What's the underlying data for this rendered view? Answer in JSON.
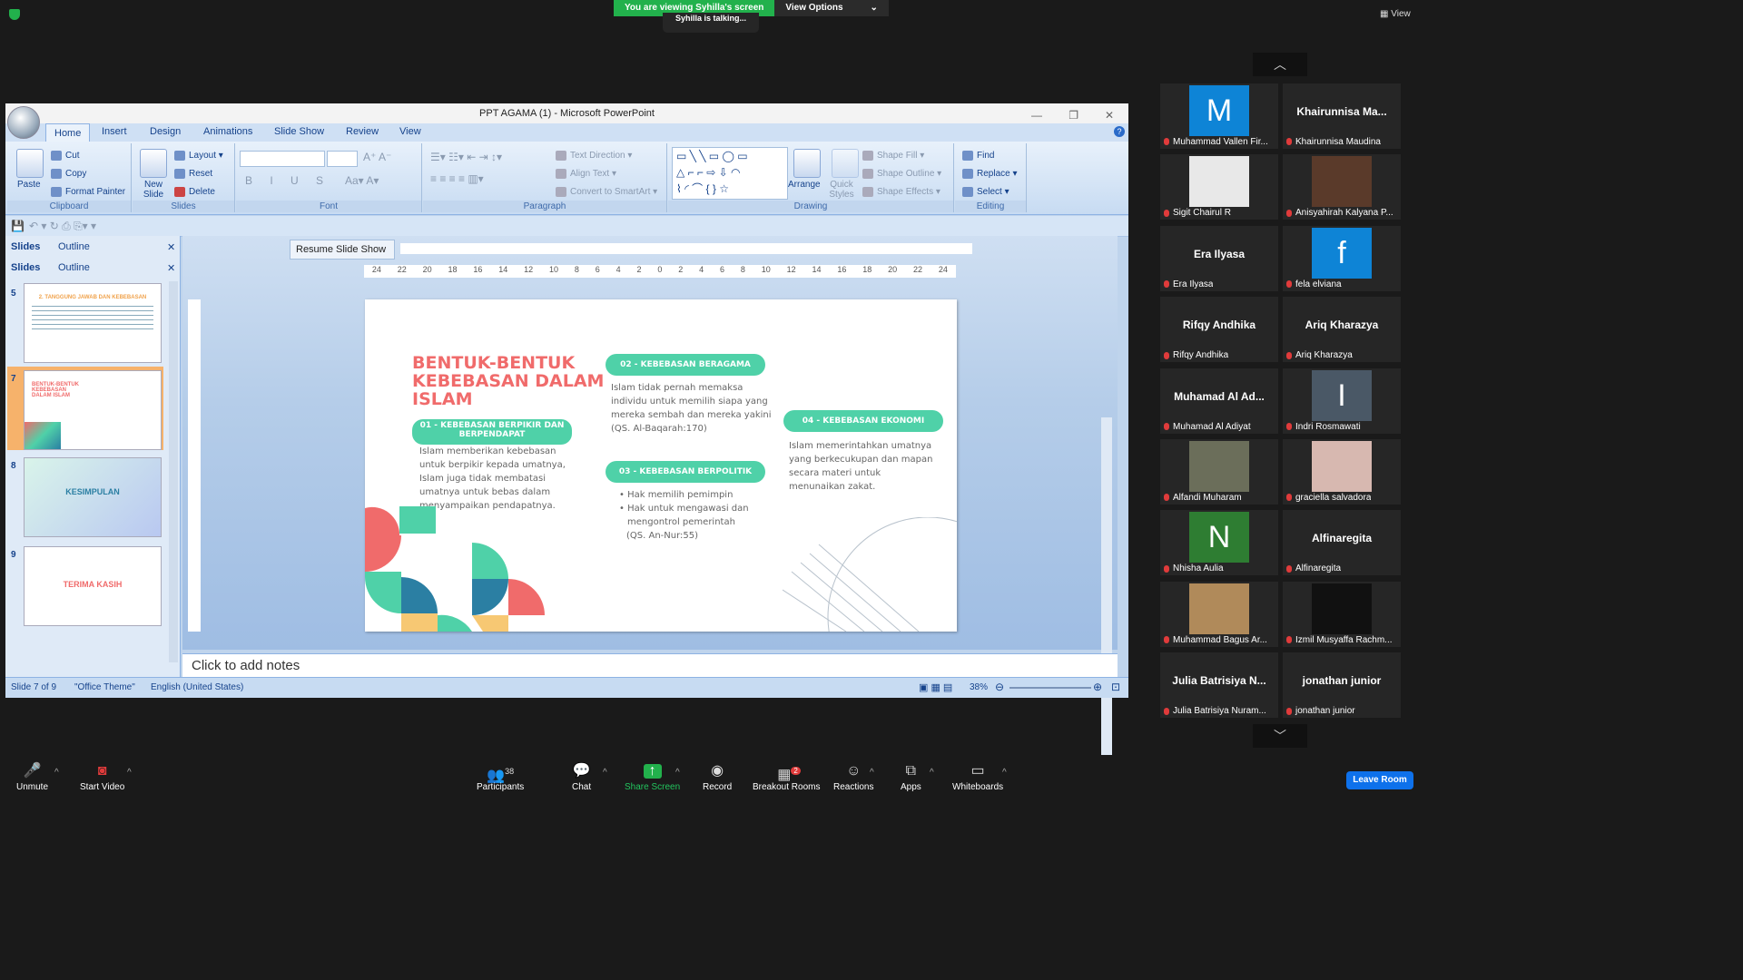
{
  "zoom_top": {
    "viewing_banner": "You are viewing Syhilla's screen",
    "view_options": "View Options",
    "talking": "Syhilla is talking...",
    "view_label": "View"
  },
  "ppt": {
    "window_title": "PPT AGAMA (1) - Microsoft PowerPoint",
    "tabs": [
      "Home",
      "Insert",
      "Design",
      "Animations",
      "Slide Show",
      "Review",
      "View"
    ],
    "ribbon": {
      "clipboard": {
        "label": "Clipboard",
        "paste": "Paste",
        "cut": "Cut",
        "copy": "Copy",
        "format_painter": "Format Painter"
      },
      "slides": {
        "label": "Slides",
        "new_slide": "New Slide",
        "layout": "Layout",
        "reset": "Reset",
        "delete": "Delete"
      },
      "font": {
        "label": "Font"
      },
      "paragraph": {
        "label": "Paragraph",
        "text_direction": "Text Direction",
        "align_text": "Align Text",
        "convert": "Convert to SmartArt"
      },
      "drawing": {
        "label": "Drawing",
        "arrange": "Arrange",
        "quick_styles": "Quick Styles",
        "shape_fill": "Shape Fill",
        "shape_outline": "Shape Outline",
        "shape_effects": "Shape Effects"
      },
      "editing": {
        "label": "Editing",
        "find": "Find",
        "replace": "Replace",
        "select": "Select"
      }
    },
    "pane_tabs": {
      "slides": "Slides",
      "outline": "Outline"
    },
    "resume_slide_show": "Resume Slide Show",
    "thumbnails": [
      {
        "num": "5",
        "title": "2. TANGGUNG JAWAB DAN KEBEBASAN"
      },
      {
        "num": "7",
        "title": "BENTUK-BENTUK KEBEBASAN DALAM ISLAM"
      },
      {
        "num": "8",
        "title": "KESIMPULAN"
      },
      {
        "num": "9",
        "title": "TERIMA KASIH"
      }
    ],
    "slide": {
      "title": "BENTUK-BENTUK KEBEBASAN DALAM ISLAM",
      "p01": "01 - KEBEBASAN BERPIKIR DAN BERPENDAPAT",
      "p01_body": "Islam memberikan kebebasan untuk berpikir kepada umatnya, Islam juga tidak membatasi umatnya untuk bebas dalam menyampaikan pendapatnya.",
      "p02": "02 - KEBEBASAN BERAGAMA",
      "p02_body": "Islam tidak pernah memaksa individu untuk memilih siapa yang mereka sembah dan mereka yakini (QS. Al-Baqarah:170)",
      "p03": "03 - KEBEBASAN BERPOLITIK",
      "p03_b1": "Hak memilih pemimpin",
      "p03_b2": "Hak untuk mengawasi dan mengontrol pemerintah",
      "p03_ref": "(QS. An-Nur:55)",
      "p04": "04 - KEBEBASAN EKONOMI",
      "p04_body": "Islam memerintahkan umatnya yang berkecukupan dan mapan secara materi untuk menunaikan zakat."
    },
    "notes_placeholder": "Click to add notes",
    "status": {
      "slide": "Slide 7 of 9",
      "theme": "\"Office Theme\"",
      "language": "English (United States)",
      "zoom": "38%"
    },
    "ruler_top": [
      "24",
      "22",
      "20",
      "18",
      "16",
      "14",
      "12",
      "10",
      "8",
      "6",
      "4",
      "2",
      "0",
      "2",
      "4",
      "6",
      "8",
      "10",
      "12",
      "14",
      "16",
      "18",
      "20",
      "22",
      "24"
    ]
  },
  "participants": [
    {
      "display": "M",
      "name": "Muhammad Vallen Fir...",
      "type": "letter",
      "color": "#0e84d6"
    },
    {
      "display": "Khairunnisa  Ma...",
      "name": "Khairunnisa Maudina",
      "type": "text"
    },
    {
      "display": "",
      "name": "Sigit Chairul R",
      "type": "photo",
      "color": "#e8e8e8"
    },
    {
      "display": "",
      "name": "Anisyahirah Kalyana P...",
      "type": "photo",
      "color": "#5a3a2a"
    },
    {
      "display": "Era Ilyasa",
      "name": "Era Ilyasa",
      "type": "text"
    },
    {
      "display": "f",
      "name": "fela elviana",
      "type": "letter",
      "color": "#0e84d6"
    },
    {
      "display": "Rifqy Andhika",
      "name": "Rifqy Andhika",
      "type": "text"
    },
    {
      "display": "Ariq Kharazya",
      "name": "Ariq Kharazya",
      "type": "text"
    },
    {
      "display": "Muhamad Al Ad...",
      "name": "Muhamad Al Adiyat",
      "type": "text"
    },
    {
      "display": "I",
      "name": "Indri Rosmawati",
      "type": "letter",
      "color": "#4a5866"
    },
    {
      "display": "",
      "name": "Alfandi Muharam",
      "type": "photo",
      "color": "#6b6e5a"
    },
    {
      "display": "",
      "name": "graciella salvadora",
      "type": "photo",
      "color": "#d7b8b0"
    },
    {
      "display": "N",
      "name": "Nhisha Aulia",
      "type": "letter",
      "color": "#2e7d32"
    },
    {
      "display": "Alfinaregita",
      "name": "Alfinaregita",
      "type": "text"
    },
    {
      "display": "",
      "name": "Muhammad Bagus Ar...",
      "type": "photo",
      "color": "#b08a5a"
    },
    {
      "display": "",
      "name": "Izmil Musyaffa Rachm...",
      "type": "photo",
      "color": "#111111"
    },
    {
      "display": "Julia Batrisiya N...",
      "name": "Julia Batrisiya Nuram...",
      "type": "text"
    },
    {
      "display": "jonathan junior",
      "name": "jonathan junior",
      "type": "text"
    }
  ],
  "bottom_bar": {
    "unmute": "Unmute",
    "start_video": "Start Video",
    "participants": "Participants",
    "participants_count": "38",
    "chat": "Chat",
    "share_screen": "Share Screen",
    "record": "Record",
    "breakout_rooms": "Breakout Rooms",
    "breakout_badge": "2",
    "reactions": "Reactions",
    "apps": "Apps",
    "whiteboards": "Whiteboards",
    "leave": "Leave Room"
  }
}
